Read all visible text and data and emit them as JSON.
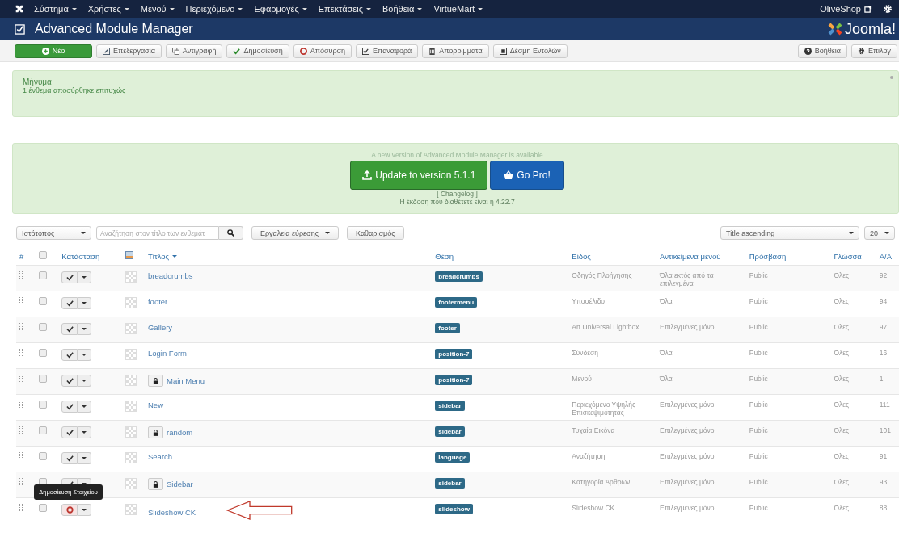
{
  "top_menu": {
    "items": [
      "Σύστημα",
      "Χρήστες",
      "Μενού",
      "Περιεχόμενο",
      "Εφαρμογές",
      "Επεκτάσεις",
      "Βοήθεια",
      "VirtueMart"
    ],
    "site_link": "OliveShop"
  },
  "header": {
    "title": "Advanced Module Manager",
    "logo": "Joomla!"
  },
  "toolbar": {
    "buttons": [
      {
        "label": "Νέο",
        "kind": "new"
      },
      {
        "label": "Επεξεργασία",
        "kind": "edit"
      },
      {
        "label": "Αντιγραφή",
        "kind": "copy"
      },
      {
        "label": "Δημοσίευση",
        "kind": "publish"
      },
      {
        "label": "Απόσυρση",
        "kind": "unpublish"
      },
      {
        "label": "Επαναφορά",
        "kind": "checkin"
      },
      {
        "label": "Απορρίμματα",
        "kind": "trash"
      },
      {
        "label": "Δέσμη Εντολών",
        "kind": "batch"
      }
    ],
    "right_buttons": [
      {
        "label": "Βοήθεια",
        "kind": "help"
      },
      {
        "label": "Επιλογ",
        "kind": "options"
      }
    ]
  },
  "message": {
    "heading": "Μήνυμα",
    "text": "1 ένθεμα αποσύρθηκε επιτυχώς"
  },
  "update": {
    "notice": "A new version of Advanced Module Manager is available",
    "update_button": "Update to version 5.1.1",
    "pro_button": "Go Pro!",
    "changelog": "[ Changelog ]",
    "current_version": "Η έκδοση που διαθέτετε είναι η 4.22.7"
  },
  "filters": {
    "site": "Ιστότοπος",
    "search": {
      "placeholder": "Αναζήτηση στον τίτλο των ενθεμάτ"
    },
    "tools_button": "Εργαλεία εύρεσης",
    "clear_button": "Καθαρισμός",
    "ordering": "Title ascending",
    "limit": "20"
  },
  "table": {
    "columns": [
      "#",
      "Κατάσταση",
      "Τίτλος",
      "Θέση",
      "Είδος",
      "Αντικείμενα μενού",
      "Πρόσβαση",
      "Γλώσσα",
      "Α/Α"
    ],
    "all_selected": false,
    "rows": [
      {
        "title": "breadcrumbs",
        "selected": false,
        "locked": false,
        "published": true,
        "position": "breadcrumbs",
        "type": "Οδηγός Πλοήγησης",
        "menu_items": "Όλα εκτός από τα επιλεγμένα",
        "access": "Public",
        "language": "Όλες",
        "id": "92"
      },
      {
        "title": "footer",
        "selected": false,
        "locked": false,
        "published": true,
        "position": "footermenu",
        "type": "Υποσέλιδο",
        "menu_items": "Όλα",
        "access": "Public",
        "language": "Όλες",
        "id": "94"
      },
      {
        "title": "Gallery",
        "selected": false,
        "locked": false,
        "published": true,
        "position": "footer",
        "type": "Art Universal Lightbox",
        "menu_items": "Επιλεγμένες μόνο",
        "access": "Public",
        "language": "Όλες",
        "id": "97"
      },
      {
        "title": "Login Form",
        "selected": false,
        "locked": false,
        "published": true,
        "position": "position-7",
        "type": "Σύνδεση",
        "menu_items": "Όλα",
        "access": "Public",
        "language": "Όλες",
        "id": "16"
      },
      {
        "title": "Main Menu",
        "selected": false,
        "locked": true,
        "published": true,
        "position": "position-7",
        "type": "Μενού",
        "menu_items": "Όλα",
        "access": "Public",
        "language": "Όλες",
        "id": "1"
      },
      {
        "title": "New",
        "selected": false,
        "locked": false,
        "published": true,
        "position": "sidebar",
        "type": "Περιεχόμενο Υψηλής Επισκεψιμότητας",
        "menu_items": "Επιλεγμένες μόνο",
        "access": "Public",
        "language": "Όλες",
        "id": "111"
      },
      {
        "title": "random",
        "selected": false,
        "locked": true,
        "published": true,
        "position": "sidebar",
        "type": "Τυχαία Εικόνα",
        "menu_items": "Επιλεγμένες μόνο",
        "access": "Public",
        "language": "Όλες",
        "id": "101"
      },
      {
        "title": "Search",
        "selected": false,
        "locked": false,
        "published": true,
        "position": "language",
        "type": "Αναζήτηση",
        "menu_items": "Επιλεγμένες μόνο",
        "access": "Public",
        "language": "Όλες",
        "id": "91"
      },
      {
        "title": "Sidebar",
        "selected": false,
        "locked": true,
        "published": true,
        "position": "sidebar",
        "type": "Κατηγορία Άρθρων",
        "menu_items": "Επιλεγμένες μόνο",
        "access": "Public",
        "language": "Όλες",
        "id": "93"
      },
      {
        "title": "Slideshow CK",
        "selected": false,
        "locked": false,
        "published": false,
        "position": "slideshow",
        "type": "Slideshow CK",
        "menu_items": "Επιλεγμένες μόνο",
        "access": "Public",
        "language": "Όλες",
        "id": "88",
        "tooltip": "Δημοσίευση Στοιχείου",
        "annotated": true
      }
    ]
  }
}
